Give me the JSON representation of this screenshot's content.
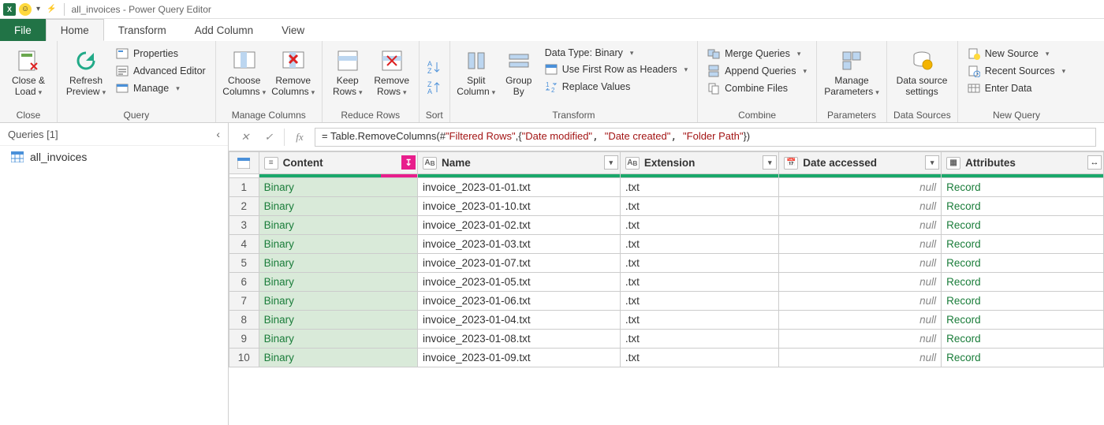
{
  "titlebar": {
    "title": "all_invoices - Power Query Editor"
  },
  "tabs": {
    "file": "File",
    "home": "Home",
    "transform": "Transform",
    "add_column": "Add Column",
    "view": "View"
  },
  "ribbon": {
    "close": {
      "close_load": "Close &\nLoad",
      "group": "Close"
    },
    "query": {
      "refresh": "Refresh\nPreview",
      "properties": "Properties",
      "advanced": "Advanced Editor",
      "manage": "Manage",
      "group": "Query"
    },
    "manage_columns": {
      "choose": "Choose\nColumns",
      "remove": "Remove\nColumns",
      "group": "Manage Columns"
    },
    "reduce_rows": {
      "keep": "Keep\nRows",
      "remove": "Remove\nRows",
      "group": "Reduce Rows"
    },
    "sort": {
      "group": "Sort"
    },
    "transform": {
      "split": "Split\nColumn",
      "groupby": "Group\nBy",
      "datatype": "Data Type: Binary",
      "first_row": "Use First Row as Headers",
      "replace": "Replace Values",
      "group": "Transform"
    },
    "combine": {
      "merge": "Merge Queries",
      "append": "Append Queries",
      "combine_files": "Combine Files",
      "group": "Combine"
    },
    "parameters": {
      "manage": "Manage\nParameters",
      "group": "Parameters"
    },
    "data_sources": {
      "settings": "Data source\nsettings",
      "group": "Data Sources"
    },
    "new_query": {
      "new_source": "New Source",
      "recent": "Recent Sources",
      "enter_data": "Enter Data",
      "group": "New Query"
    }
  },
  "queries": {
    "header": "Queries [1]",
    "items": [
      "all_invoices"
    ]
  },
  "formula": {
    "prefix": "= Table.RemoveColumns(#",
    "arg1": "\"Filtered Rows\"",
    "mid": ",{",
    "s1": "\"Date modified\"",
    "s2": "\"Date created\"",
    "s3": "\"Folder Path\"",
    "end": "})"
  },
  "grid": {
    "columns": {
      "content": "Content",
      "name": "Name",
      "extension": "Extension",
      "date_accessed": "Date accessed",
      "attributes": "Attributes"
    },
    "null_label": "null",
    "record_label": "Record",
    "binary_label": "Binary",
    "rows": [
      {
        "n": "1",
        "name": "invoice_2023-01-01.txt",
        "ext": ".txt"
      },
      {
        "n": "2",
        "name": "invoice_2023-01-10.txt",
        "ext": ".txt"
      },
      {
        "n": "3",
        "name": "invoice_2023-01-02.txt",
        "ext": ".txt"
      },
      {
        "n": "4",
        "name": "invoice_2023-01-03.txt",
        "ext": ".txt"
      },
      {
        "n": "5",
        "name": "invoice_2023-01-07.txt",
        "ext": ".txt"
      },
      {
        "n": "6",
        "name": "invoice_2023-01-05.txt",
        "ext": ".txt"
      },
      {
        "n": "7",
        "name": "invoice_2023-01-06.txt",
        "ext": ".txt"
      },
      {
        "n": "8",
        "name": "invoice_2023-01-04.txt",
        "ext": ".txt"
      },
      {
        "n": "9",
        "name": "invoice_2023-01-08.txt",
        "ext": ".txt"
      },
      {
        "n": "10",
        "name": "invoice_2023-01-09.txt",
        "ext": ".txt"
      }
    ]
  }
}
